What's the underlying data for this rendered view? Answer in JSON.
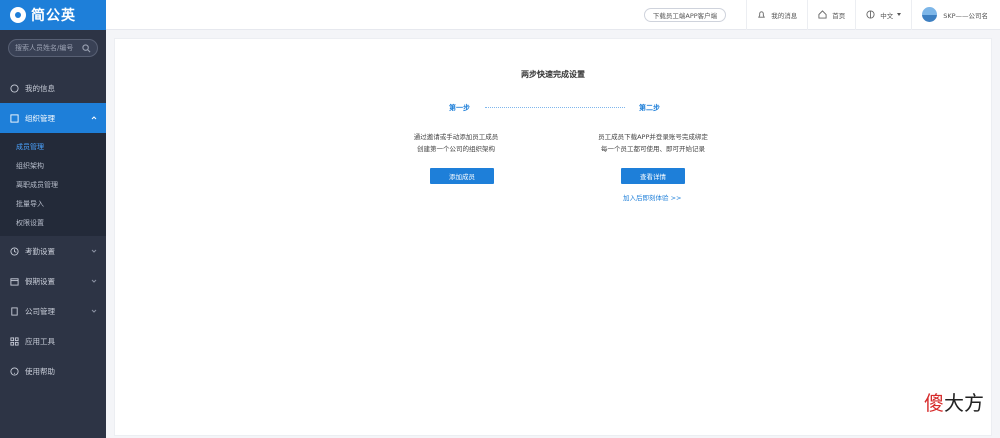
{
  "app": {
    "name": "简公英"
  },
  "sidebar": {
    "search_placeholder": "搜索人员姓名/编号",
    "menu": [
      {
        "label": "我的信息",
        "icon": "home-icon",
        "active": false
      },
      {
        "label": "组织管理",
        "icon": "org-icon",
        "active": true
      }
    ],
    "submenu": [
      {
        "label": "成员管理",
        "current": true
      },
      {
        "label": "组织架构",
        "current": false
      },
      {
        "label": "离职成员管理",
        "current": false
      },
      {
        "label": "批量导入",
        "current": false
      },
      {
        "label": "权限设置",
        "current": false
      }
    ],
    "menu_after": [
      {
        "label": "考勤设置",
        "icon": "clock-icon"
      },
      {
        "label": "假期设置",
        "icon": "calendar-icon"
      },
      {
        "label": "公司管理",
        "icon": "building-icon"
      },
      {
        "label": "应用工具",
        "icon": "grid-icon"
      },
      {
        "label": "使用帮助",
        "icon": "help-icon"
      }
    ]
  },
  "header": {
    "download_btn": "下载员工端APP客户端",
    "notice": "我的消息",
    "home": "首页",
    "lang": "中文",
    "user": "SKP——公司名"
  },
  "main": {
    "title": "两步快速完成设置",
    "step1_label": "第一步",
    "step2_label": "第二步",
    "step1_text": [
      "通过邀请或手动添加员工成员",
      "创建第一个公司的组织架构"
    ],
    "step2_text": [
      "员工成员下载APP并登录账号完成绑定",
      "每一个员工都可使用、即可开始记录"
    ],
    "step1_button": "添加成员",
    "step2_button": "查看详情",
    "step2_link": "加入后即刻体验 >>"
  },
  "watermark": {
    "first": "傻",
    "rest": "大方"
  }
}
